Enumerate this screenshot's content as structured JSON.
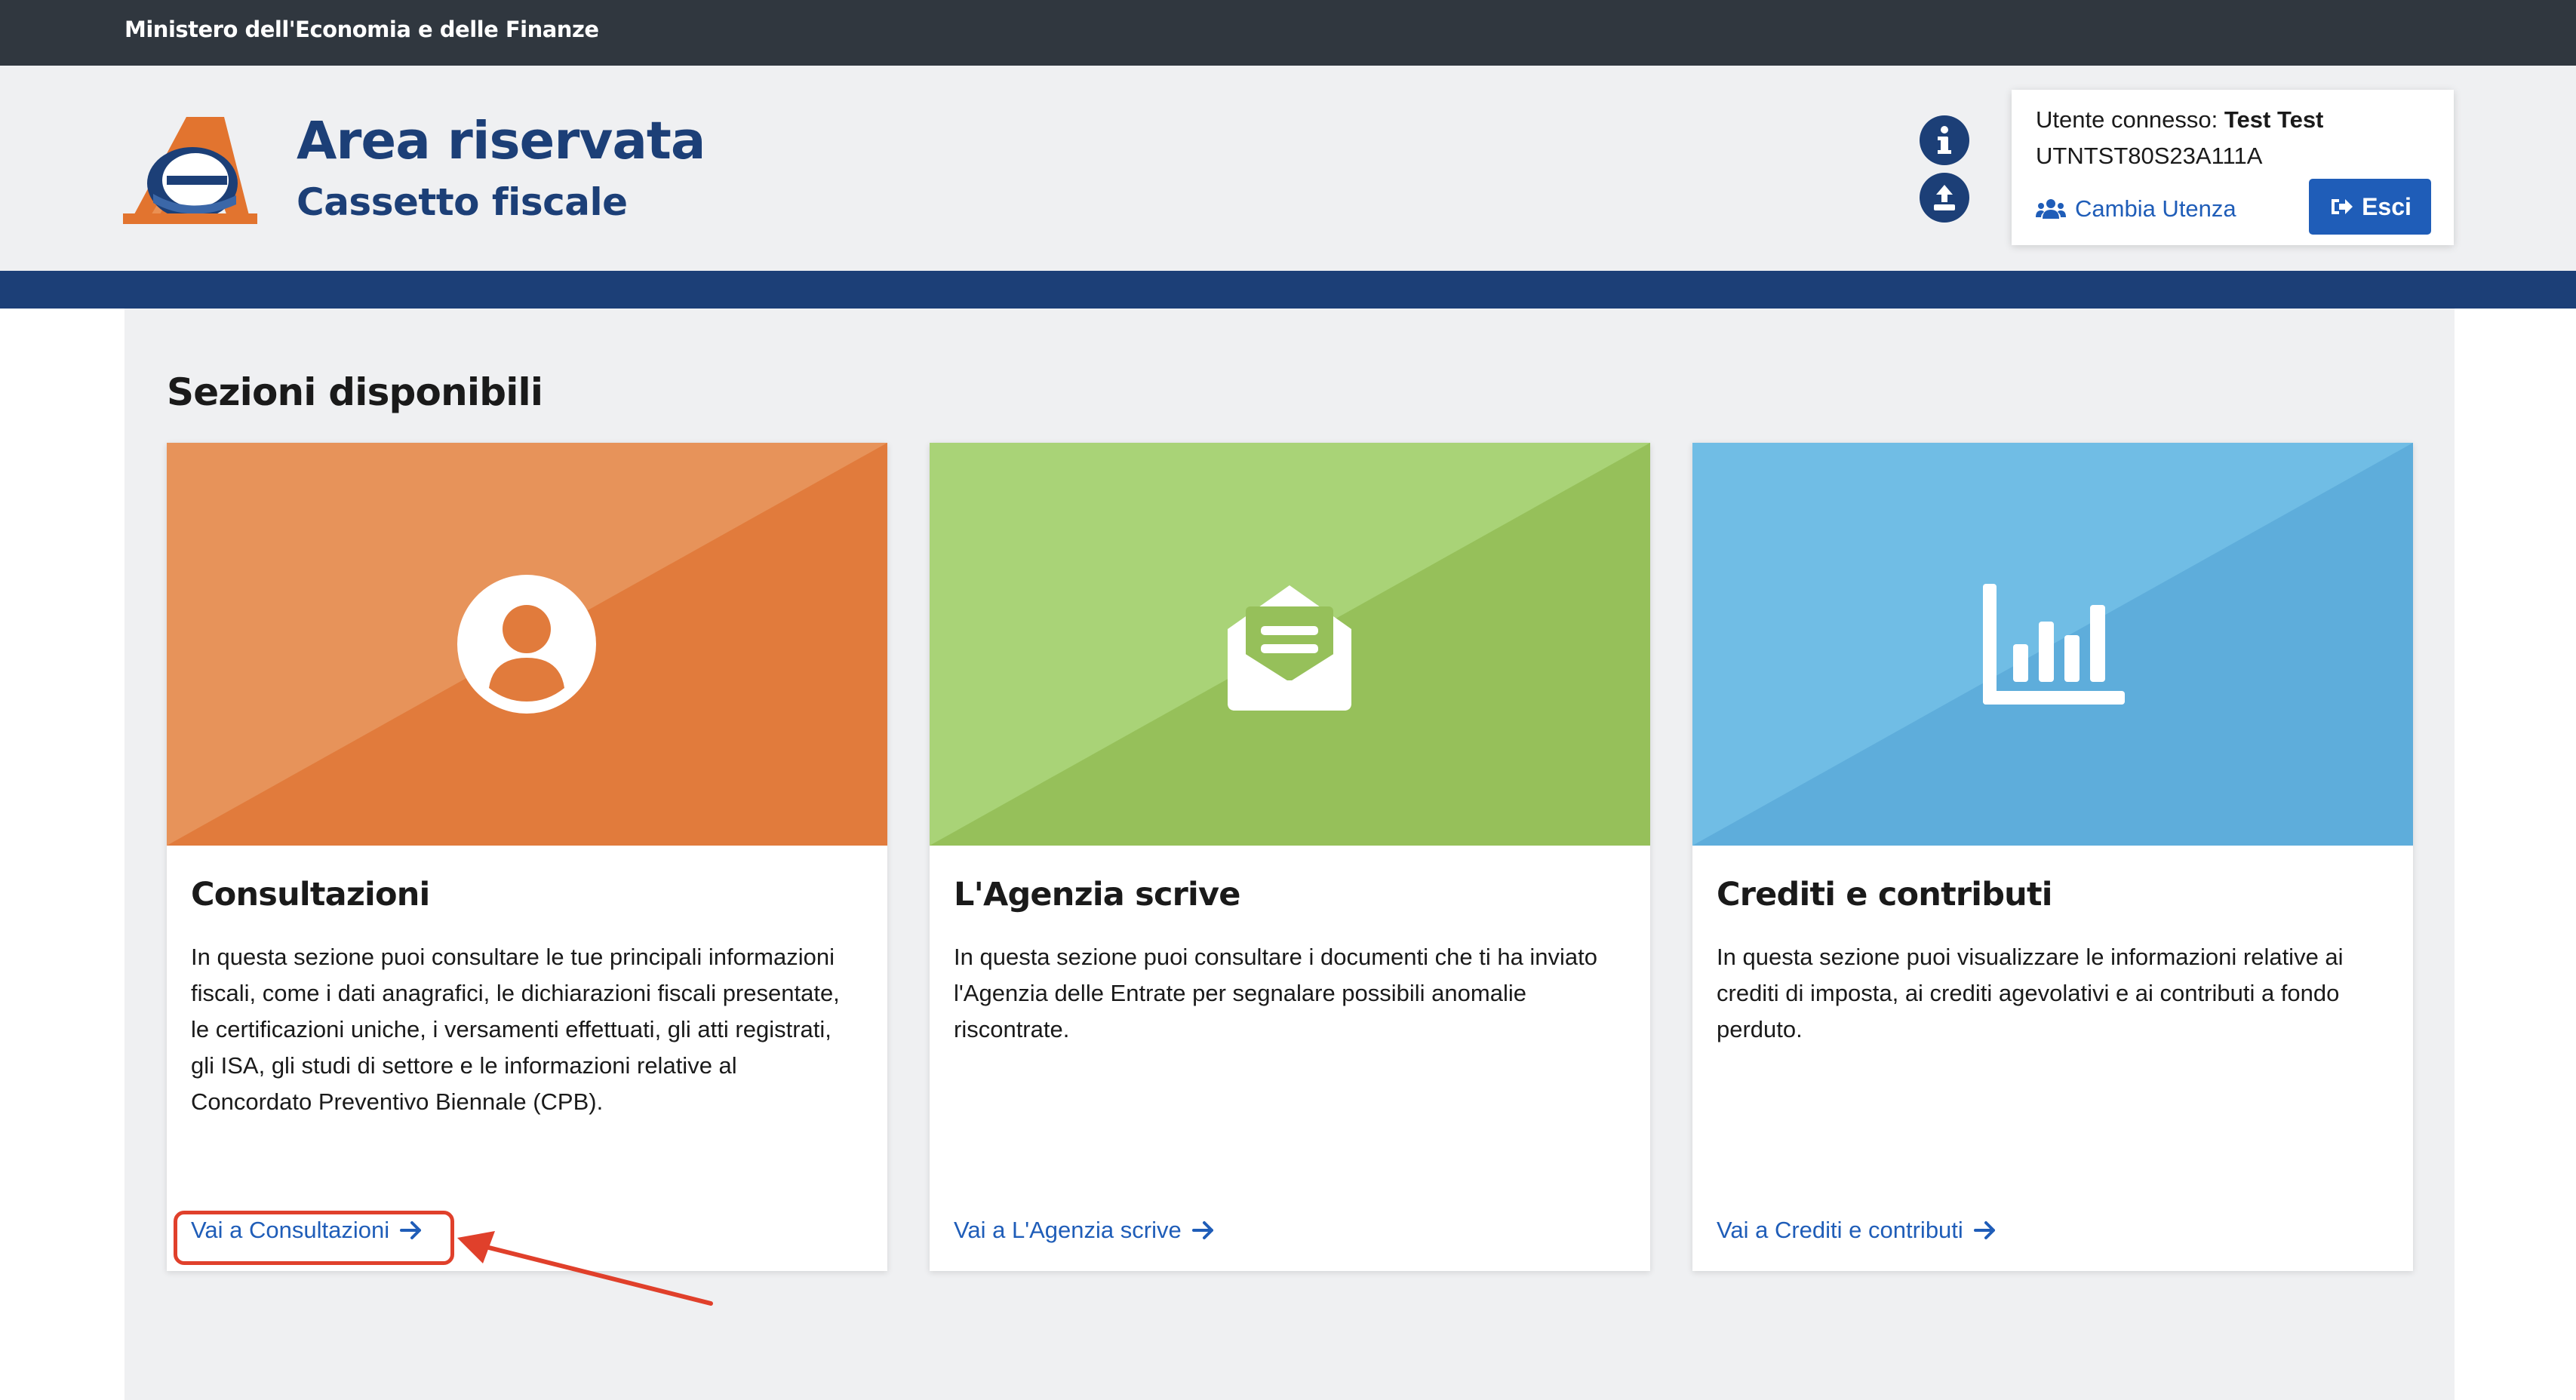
{
  "topbar": {
    "ministry": "Ministero dell'Economia e delle Finanze"
  },
  "header": {
    "title": "Area riservata",
    "subtitle": "Cassetto fiscale",
    "icons": [
      "info-icon",
      "upload-icon"
    ]
  },
  "user": {
    "label": "Utente connesso:",
    "name": "Test Test",
    "code": "UTNTST80S23A111A",
    "switch_label": "Cambia Utenza",
    "logout_label": "Esci"
  },
  "main": {
    "section_title": "Sezioni disponibili",
    "cards": [
      {
        "title": "Consultazioni",
        "text": "In questa sezione puoi consultare le tue principali informazioni fiscali, come i dati anagrafici, le dichiarazioni fiscali presentate, le certificazioni uniche, i versamenti effettuati, gli atti registrati, gli ISA, gli studi di settore e le informazioni relative al Concordato Preventivo Biennale (CPB).",
        "link": "Vai a Consultazioni",
        "icon": "user-icon",
        "color": "#e17b3c"
      },
      {
        "title": "L'Agenzia scrive",
        "text": "In questa sezione puoi consultare i documenti che ti ha inviato l'Agenzia delle Entrate per segnalare possibili anomalie riscontrate.",
        "link": "Vai a L'Agenzia scrive",
        "icon": "envelope-open-icon",
        "color": "#96c05a"
      },
      {
        "title": "Crediti e contributi",
        "text": "In questa sezione puoi visualizzare le informazioni relative ai crediti di imposta, ai crediti agevolativi e ai contributi a fondo perduto.",
        "link": "Vai a Crediti e contributi",
        "icon": "bar-chart-icon",
        "color": "#5eaddb"
      }
    ]
  },
  "colors": {
    "primary": "#1c3f77",
    "link": "#1f5db8",
    "annotation": "#e0402b"
  }
}
